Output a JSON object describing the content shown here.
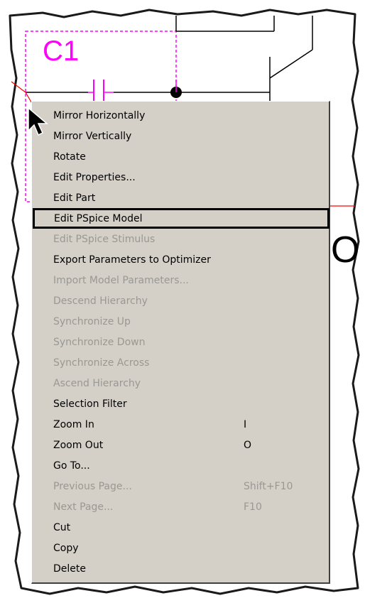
{
  "schematic": {
    "part_label": "C1",
    "right_label": "O"
  },
  "context_menu": {
    "items": [
      {
        "label": "Mirror Horizontally",
        "shortcut": "",
        "disabled": false
      },
      {
        "label": "Mirror Vertically",
        "shortcut": "",
        "disabled": false
      },
      {
        "label": "Rotate",
        "shortcut": "",
        "disabled": false
      },
      {
        "label": "Edit Properties...",
        "shortcut": "",
        "disabled": false
      },
      {
        "label": "Edit Part",
        "shortcut": "",
        "disabled": false
      },
      {
        "label": "Edit PSpice Model",
        "shortcut": "",
        "disabled": false,
        "highlighted": true
      },
      {
        "label": "Edit PSpice Stimulus",
        "shortcut": "",
        "disabled": true
      },
      {
        "label": "Export Parameters to Optimizer",
        "shortcut": "",
        "disabled": false
      },
      {
        "label": "Import Model Parameters...",
        "shortcut": "",
        "disabled": true
      },
      {
        "label": "Descend Hierarchy",
        "shortcut": "",
        "disabled": true
      },
      {
        "label": "Synchronize Up",
        "shortcut": "",
        "disabled": true
      },
      {
        "label": "Synchronize Down",
        "shortcut": "",
        "disabled": true
      },
      {
        "label": "Synchronize Across",
        "shortcut": "",
        "disabled": true
      },
      {
        "label": "Ascend Hierarchy",
        "shortcut": "",
        "disabled": true
      },
      {
        "label": "Selection Filter",
        "shortcut": "",
        "disabled": false
      },
      {
        "label": "Zoom In",
        "shortcut": "I",
        "disabled": false
      },
      {
        "label": "Zoom Out",
        "shortcut": "O",
        "disabled": false
      },
      {
        "label": "Go To...",
        "shortcut": "",
        "disabled": false
      },
      {
        "label": "Previous Page...",
        "shortcut": "Shift+F10",
        "disabled": true
      },
      {
        "label": "Next Page...",
        "shortcut": "F10",
        "disabled": true
      },
      {
        "label": "Cut",
        "shortcut": "",
        "disabled": false
      },
      {
        "label": "Copy",
        "shortcut": "",
        "disabled": false
      },
      {
        "label": "Delete",
        "shortcut": "",
        "disabled": false
      }
    ]
  },
  "colors": {
    "menu_bg": "#d4d0c8",
    "disabled_text": "#9a9893",
    "part_outline": "#ff00ff",
    "wire_highlight": "#ff0000"
  },
  "icons": [
    "mouse-pointer-icon"
  ]
}
